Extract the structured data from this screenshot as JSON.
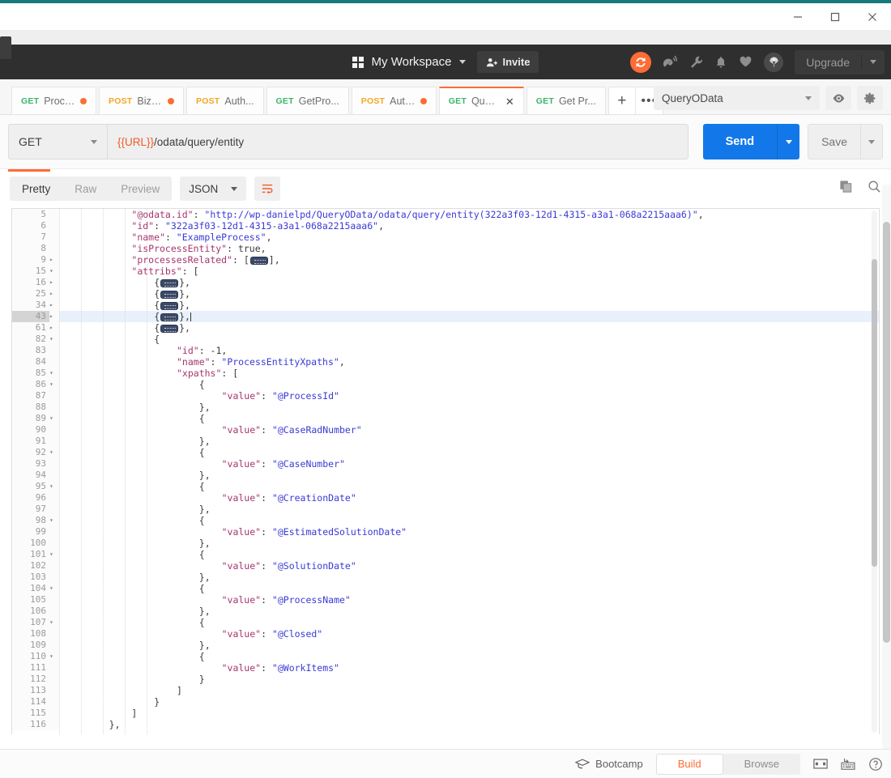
{
  "window": {
    "minimize_label": "minimize-window",
    "maximize_label": "maximize-window",
    "close_label": "close-window"
  },
  "header": {
    "workspace_name": "My Workspace",
    "invite_label": "Invite",
    "upgrade_label": "Upgrade",
    "icons": [
      "sync-icon",
      "satellite-dish-icon",
      "wrench-icon",
      "bell-icon",
      "heart-icon",
      "parachute-icon"
    ],
    "accent_color": "#ff6c37",
    "background_color": "#2f2f2f"
  },
  "tabs": {
    "items": [
      {
        "method": "GET",
        "label": "Process...",
        "unsaved": true,
        "active": false
      },
      {
        "method": "POST",
        "label": "Bizagi ...",
        "unsaved": true,
        "active": false
      },
      {
        "method": "POST",
        "label": "Auth...",
        "unsaved": false,
        "active": false
      },
      {
        "method": "GET",
        "label": "GetPro...",
        "unsaved": false,
        "active": false
      },
      {
        "method": "POST",
        "label": "Authe...",
        "unsaved": true,
        "active": false
      },
      {
        "method": "GET",
        "label": "Query ...",
        "unsaved": false,
        "active": true
      },
      {
        "method": "GET",
        "label": "Get Pr...",
        "unsaved": false,
        "active": false
      }
    ],
    "new_tab_label": "+",
    "more_label": "•••",
    "environment": "QueryOData",
    "eye_icon": "eye-icon",
    "gear_icon": "gear-icon"
  },
  "request": {
    "method": "GET",
    "url_variable": "{{URL}}",
    "url_path": "/odata/query/entity",
    "send_label": "Send",
    "save_label": "Save"
  },
  "response": {
    "view_tabs": [
      {
        "label": "Pretty",
        "active": true
      },
      {
        "label": "Raw",
        "active": false
      },
      {
        "label": "Preview",
        "active": false
      }
    ],
    "format": "JSON",
    "wrap_icon": "word-wrap-icon",
    "copy_icon": "copy-icon",
    "search_icon": "search-icon",
    "active_line": 43,
    "lines": [
      {
        "num": "5",
        "fold": "",
        "indent": 3,
        "segs": [
          {
            "t": "k",
            "v": "\"@odata.id\""
          },
          {
            "t": "b",
            "v": ": "
          },
          {
            "t": "s",
            "v": "\"http://wp-danielpd/QueryOData/odata/query/entity(322a3f03-12d1-4315-a3a1-068a2215aaa6)\""
          },
          {
            "t": "b",
            "v": ","
          }
        ]
      },
      {
        "num": "6",
        "fold": "",
        "indent": 3,
        "segs": [
          {
            "t": "k",
            "v": "\"id\""
          },
          {
            "t": "b",
            "v": ": "
          },
          {
            "t": "s",
            "v": "\"322a3f03-12d1-4315-a3a1-068a2215aaa6\""
          },
          {
            "t": "b",
            "v": ","
          }
        ]
      },
      {
        "num": "7",
        "fold": "",
        "indent": 3,
        "segs": [
          {
            "t": "k",
            "v": "\"name\""
          },
          {
            "t": "b",
            "v": ": "
          },
          {
            "t": "s",
            "v": "\"ExampleProcess\""
          },
          {
            "t": "b",
            "v": ","
          }
        ]
      },
      {
        "num": "8",
        "fold": "",
        "indent": 3,
        "segs": [
          {
            "t": "k",
            "v": "\"isProcessEntity\""
          },
          {
            "t": "b",
            "v": ": true,"
          }
        ]
      },
      {
        "num": "9",
        "fold": "▸",
        "indent": 3,
        "segs": [
          {
            "t": "k",
            "v": "\"processesRelated\""
          },
          {
            "t": "b",
            "v": ": ["
          },
          {
            "t": "fold",
            "v": ""
          },
          {
            "t": "b",
            "v": "],"
          }
        ]
      },
      {
        "num": "15",
        "fold": "▾",
        "indent": 3,
        "segs": [
          {
            "t": "k",
            "v": "\"attribs\""
          },
          {
            "t": "b",
            "v": ": ["
          }
        ]
      },
      {
        "num": "16",
        "fold": "▸",
        "indent": 4,
        "segs": [
          {
            "t": "b",
            "v": "{"
          },
          {
            "t": "fold",
            "v": ""
          },
          {
            "t": "b",
            "v": "},"
          }
        ]
      },
      {
        "num": "25",
        "fold": "▸",
        "indent": 4,
        "segs": [
          {
            "t": "b",
            "v": "{"
          },
          {
            "t": "fold",
            "v": ""
          },
          {
            "t": "b",
            "v": "},"
          }
        ]
      },
      {
        "num": "34",
        "fold": "▸",
        "indent": 4,
        "segs": [
          {
            "t": "b",
            "v": "{"
          },
          {
            "t": "fold",
            "v": ""
          },
          {
            "t": "b",
            "v": "},"
          }
        ]
      },
      {
        "num": "43",
        "fold": "▸",
        "indent": 4,
        "segs": [
          {
            "t": "b",
            "v": "{"
          },
          {
            "t": "fold",
            "v": ""
          },
          {
            "t": "b",
            "v": "},"
          },
          {
            "t": "caret",
            "v": ""
          }
        ]
      },
      {
        "num": "61",
        "fold": "▸",
        "indent": 4,
        "segs": [
          {
            "t": "b",
            "v": "{"
          },
          {
            "t": "fold",
            "v": ""
          },
          {
            "t": "b",
            "v": "},"
          }
        ]
      },
      {
        "num": "82",
        "fold": "▾",
        "indent": 4,
        "segs": [
          {
            "t": "b",
            "v": "{"
          }
        ]
      },
      {
        "num": "83",
        "fold": "",
        "indent": 5,
        "segs": [
          {
            "t": "k",
            "v": "\"id\""
          },
          {
            "t": "b",
            "v": ": -1,"
          }
        ]
      },
      {
        "num": "84",
        "fold": "",
        "indent": 5,
        "segs": [
          {
            "t": "k",
            "v": "\"name\""
          },
          {
            "t": "b",
            "v": ": "
          },
          {
            "t": "s",
            "v": "\"ProcessEntityXpaths\""
          },
          {
            "t": "b",
            "v": ","
          }
        ]
      },
      {
        "num": "85",
        "fold": "▾",
        "indent": 5,
        "segs": [
          {
            "t": "k",
            "v": "\"xpaths\""
          },
          {
            "t": "b",
            "v": ": ["
          }
        ]
      },
      {
        "num": "86",
        "fold": "▾",
        "indent": 6,
        "segs": [
          {
            "t": "b",
            "v": "{"
          }
        ]
      },
      {
        "num": "87",
        "fold": "",
        "indent": 7,
        "segs": [
          {
            "t": "k",
            "v": "\"value\""
          },
          {
            "t": "b",
            "v": ": "
          },
          {
            "t": "s",
            "v": "\"@ProcessId\""
          }
        ]
      },
      {
        "num": "88",
        "fold": "",
        "indent": 6,
        "segs": [
          {
            "t": "b",
            "v": "},"
          }
        ]
      },
      {
        "num": "89",
        "fold": "▾",
        "indent": 6,
        "segs": [
          {
            "t": "b",
            "v": "{"
          }
        ]
      },
      {
        "num": "90",
        "fold": "",
        "indent": 7,
        "segs": [
          {
            "t": "k",
            "v": "\"value\""
          },
          {
            "t": "b",
            "v": ": "
          },
          {
            "t": "s",
            "v": "\"@CaseRadNumber\""
          }
        ]
      },
      {
        "num": "91",
        "fold": "",
        "indent": 6,
        "segs": [
          {
            "t": "b",
            "v": "},"
          }
        ]
      },
      {
        "num": "92",
        "fold": "▾",
        "indent": 6,
        "segs": [
          {
            "t": "b",
            "v": "{"
          }
        ]
      },
      {
        "num": "93",
        "fold": "",
        "indent": 7,
        "segs": [
          {
            "t": "k",
            "v": "\"value\""
          },
          {
            "t": "b",
            "v": ": "
          },
          {
            "t": "s",
            "v": "\"@CaseNumber\""
          }
        ]
      },
      {
        "num": "94",
        "fold": "",
        "indent": 6,
        "segs": [
          {
            "t": "b",
            "v": "},"
          }
        ]
      },
      {
        "num": "95",
        "fold": "▾",
        "indent": 6,
        "segs": [
          {
            "t": "b",
            "v": "{"
          }
        ]
      },
      {
        "num": "96",
        "fold": "",
        "indent": 7,
        "segs": [
          {
            "t": "k",
            "v": "\"value\""
          },
          {
            "t": "b",
            "v": ": "
          },
          {
            "t": "s",
            "v": "\"@CreationDate\""
          }
        ]
      },
      {
        "num": "97",
        "fold": "",
        "indent": 6,
        "segs": [
          {
            "t": "b",
            "v": "},"
          }
        ]
      },
      {
        "num": "98",
        "fold": "▾",
        "indent": 6,
        "segs": [
          {
            "t": "b",
            "v": "{"
          }
        ]
      },
      {
        "num": "99",
        "fold": "",
        "indent": 7,
        "segs": [
          {
            "t": "k",
            "v": "\"value\""
          },
          {
            "t": "b",
            "v": ": "
          },
          {
            "t": "s",
            "v": "\"@EstimatedSolutionDate\""
          }
        ]
      },
      {
        "num": "100",
        "fold": "",
        "indent": 6,
        "segs": [
          {
            "t": "b",
            "v": "},"
          }
        ]
      },
      {
        "num": "101",
        "fold": "▾",
        "indent": 6,
        "segs": [
          {
            "t": "b",
            "v": "{"
          }
        ]
      },
      {
        "num": "102",
        "fold": "",
        "indent": 7,
        "segs": [
          {
            "t": "k",
            "v": "\"value\""
          },
          {
            "t": "b",
            "v": ": "
          },
          {
            "t": "s",
            "v": "\"@SolutionDate\""
          }
        ]
      },
      {
        "num": "103",
        "fold": "",
        "indent": 6,
        "segs": [
          {
            "t": "b",
            "v": "},"
          }
        ]
      },
      {
        "num": "104",
        "fold": "▾",
        "indent": 6,
        "segs": [
          {
            "t": "b",
            "v": "{"
          }
        ]
      },
      {
        "num": "105",
        "fold": "",
        "indent": 7,
        "segs": [
          {
            "t": "k",
            "v": "\"value\""
          },
          {
            "t": "b",
            "v": ": "
          },
          {
            "t": "s",
            "v": "\"@ProcessName\""
          }
        ]
      },
      {
        "num": "106",
        "fold": "",
        "indent": 6,
        "segs": [
          {
            "t": "b",
            "v": "},"
          }
        ]
      },
      {
        "num": "107",
        "fold": "▾",
        "indent": 6,
        "segs": [
          {
            "t": "b",
            "v": "{"
          }
        ]
      },
      {
        "num": "108",
        "fold": "",
        "indent": 7,
        "segs": [
          {
            "t": "k",
            "v": "\"value\""
          },
          {
            "t": "b",
            "v": ": "
          },
          {
            "t": "s",
            "v": "\"@Closed\""
          }
        ]
      },
      {
        "num": "109",
        "fold": "",
        "indent": 6,
        "segs": [
          {
            "t": "b",
            "v": "},"
          }
        ]
      },
      {
        "num": "110",
        "fold": "▾",
        "indent": 6,
        "segs": [
          {
            "t": "b",
            "v": "{"
          }
        ]
      },
      {
        "num": "111",
        "fold": "",
        "indent": 7,
        "segs": [
          {
            "t": "k",
            "v": "\"value\""
          },
          {
            "t": "b",
            "v": ": "
          },
          {
            "t": "s",
            "v": "\"@WorkItems\""
          }
        ]
      },
      {
        "num": "112",
        "fold": "",
        "indent": 6,
        "segs": [
          {
            "t": "b",
            "v": "}"
          }
        ]
      },
      {
        "num": "113",
        "fold": "",
        "indent": 5,
        "segs": [
          {
            "t": "b",
            "v": "]"
          }
        ]
      },
      {
        "num": "114",
        "fold": "",
        "indent": 4,
        "segs": [
          {
            "t": "b",
            "v": "}"
          }
        ]
      },
      {
        "num": "115",
        "fold": "",
        "indent": 3,
        "segs": [
          {
            "t": "b",
            "v": "]"
          }
        ]
      },
      {
        "num": "116",
        "fold": "",
        "indent": 2,
        "segs": [
          {
            "t": "b",
            "v": "},"
          }
        ]
      }
    ]
  },
  "footer": {
    "bootcamp_label": "Bootcamp",
    "bootcamp_icon": "graduation-cap-icon",
    "build_label": "Build",
    "browse_label": "Browse",
    "layout_icon": "two-pane-layout-icon",
    "keyboard_icon": "keyboard-shortcuts-icon",
    "help_icon": "help-icon"
  }
}
